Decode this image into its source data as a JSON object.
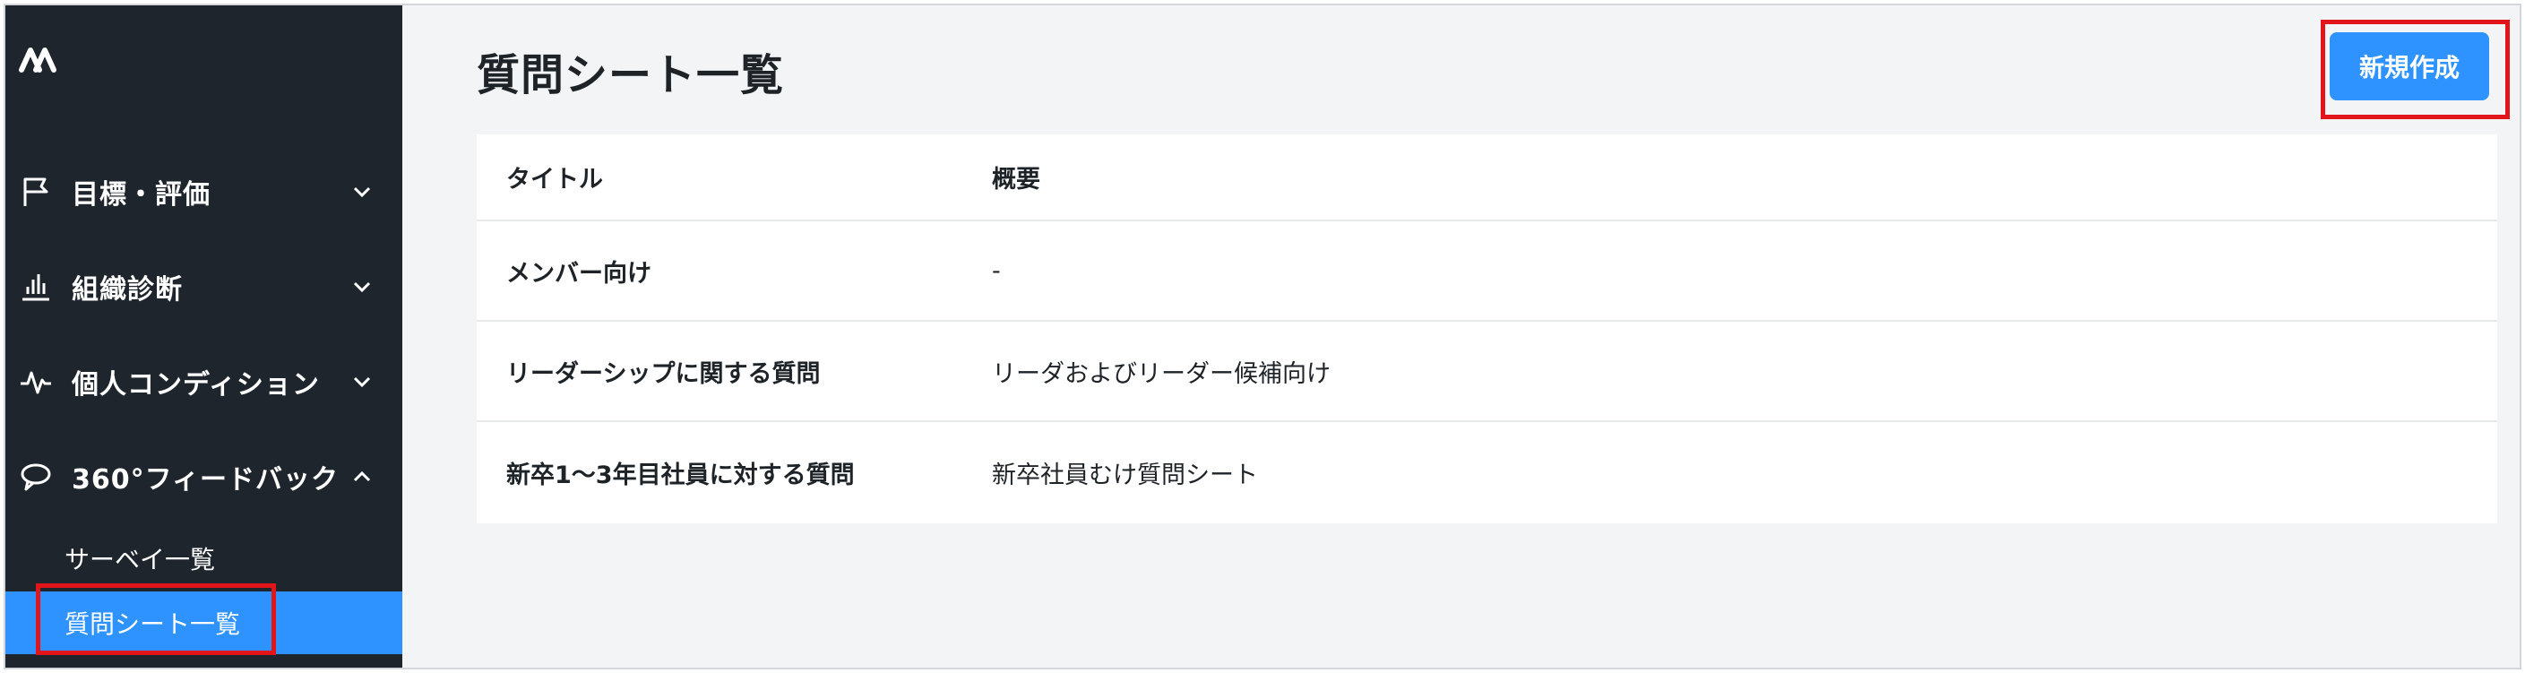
{
  "sidebar": {
    "logo": "M",
    "nav": [
      {
        "label": "目標・評価",
        "icon": "flag-icon",
        "expanded": false
      },
      {
        "label": "組織診断",
        "icon": "bar-chart-icon",
        "expanded": false
      },
      {
        "label": "個人コンディション",
        "icon": "pulse-icon",
        "expanded": false
      },
      {
        "label": "360°フィードバック",
        "icon": "feedback-loop-icon",
        "expanded": true
      }
    ],
    "sub_items": [
      {
        "label": "サーベイ一覧",
        "active": false
      },
      {
        "label": "質問シート一覧",
        "active": true
      }
    ]
  },
  "header": {
    "title": "質問シート一覧",
    "new_button_label": "新規作成"
  },
  "table": {
    "columns": [
      "タイトル",
      "概要"
    ],
    "rows": [
      {
        "title": "メンバー向け",
        "summary": "-"
      },
      {
        "title": "リーダーシップに関する質問",
        "summary": "リーダおよびリーダー候補向け"
      },
      {
        "title": "新卒1〜3年目社員に対する質問",
        "summary": "新卒社員むけ質問シート"
      }
    ]
  },
  "colors": {
    "sidebar_bg": "#1f252d",
    "accent": "#2f93ff",
    "highlight": "#e0161b",
    "content_bg": "#f3f4f6"
  }
}
